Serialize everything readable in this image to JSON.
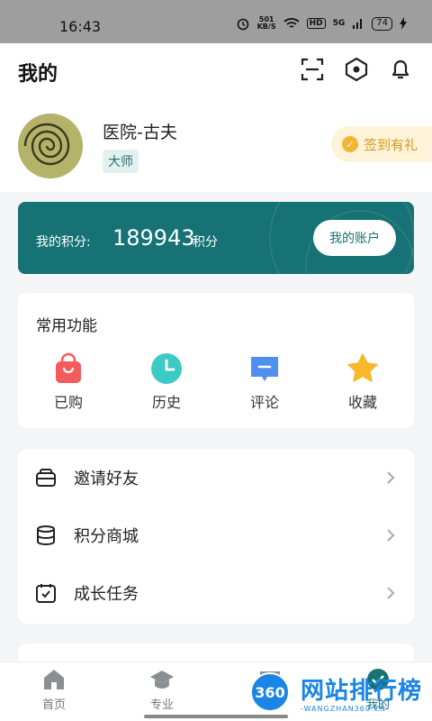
{
  "status": {
    "time": "16:43",
    "speed": "501",
    "speed_unit": "KB/S",
    "hd": "HD",
    "network": "5G",
    "battery": "74"
  },
  "header": {
    "title": "我的",
    "icons": [
      "scan-icon",
      "settings-icon",
      "bell-icon"
    ]
  },
  "profile": {
    "name": "医院-古夫",
    "badge": "大师",
    "checkin_label": "签到有礼"
  },
  "points": {
    "label": "我的积分:",
    "value": "189943",
    "unit": "积分",
    "account_button": "我的账户"
  },
  "functions": {
    "title": "常用功能",
    "items": [
      {
        "label": "已购",
        "icon": "shopping-bag-icon",
        "color": "#f45b5b"
      },
      {
        "label": "历史",
        "icon": "clock-icon",
        "color": "#3ccbc4"
      },
      {
        "label": "评论",
        "icon": "comment-icon",
        "color": "#4f8ff0"
      },
      {
        "label": "收藏",
        "icon": "star-icon",
        "color": "#f7b82c"
      }
    ]
  },
  "menu": {
    "items": [
      {
        "label": "邀请好友",
        "icon": "invite-mail-icon"
      },
      {
        "label": "积分商城",
        "icon": "coins-stack-icon"
      },
      {
        "label": "成长任务",
        "icon": "calendar-check-icon"
      }
    ]
  },
  "tabs": [
    {
      "label": "首页",
      "icon": "home-icon"
    },
    {
      "label": "专业",
      "icon": "graduation-cap-icon"
    },
    {
      "label": "问询",
      "icon": "chat-icon"
    },
    {
      "label": "我的",
      "icon": "profile-icon",
      "active": true
    }
  ],
  "watermark": {
    "badge": "360",
    "title": "网站排行榜",
    "url": "-WANGZHAN360.CN-"
  },
  "colors": {
    "accent": "#167274",
    "checkin": "#d99a22"
  }
}
